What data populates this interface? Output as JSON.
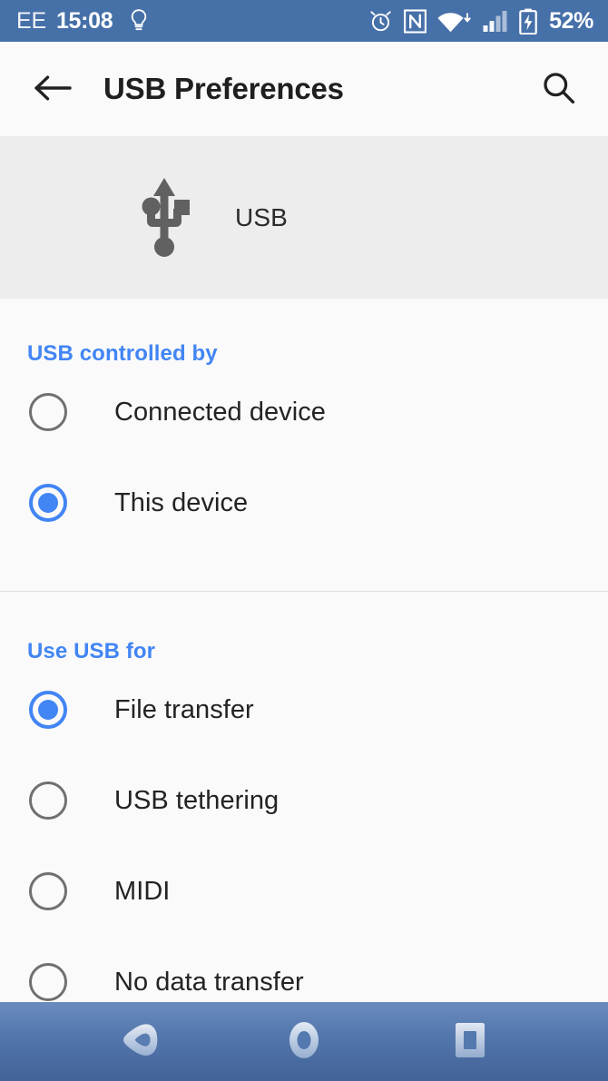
{
  "status_bar": {
    "carrier": "EE",
    "time": "15:08",
    "battery_percent": "52%",
    "background_color": "#4670A8",
    "icons": [
      {
        "name": "flashlight-bulb-icon",
        "label": "Flashlight"
      },
      {
        "name": "alarm-clock-icon",
        "label": "Alarm set"
      },
      {
        "name": "nfc-icon",
        "label": "NFC enabled"
      },
      {
        "name": "wifi-icon",
        "label": "Wi-Fi"
      },
      {
        "name": "cellular-signal-icon",
        "label": "Cellular signal"
      },
      {
        "name": "battery-charging-icon",
        "label": "Battery charging"
      }
    ]
  },
  "app_bar": {
    "title": "USB Preferences",
    "back_label": "Back",
    "search_label": "Search"
  },
  "usb_banner": {
    "label": "USB",
    "background_color": "#EDEDED",
    "icon": "usb-trident-icon"
  },
  "sections": [
    {
      "header": "USB controlled by",
      "header_color": "#4285F4",
      "options": [
        {
          "label": "Connected device",
          "selected": false
        },
        {
          "label": "This device",
          "selected": true
        }
      ]
    },
    {
      "header": "Use USB for",
      "header_color": "#4285F4",
      "options": [
        {
          "label": "File transfer",
          "selected": true
        },
        {
          "label": "USB tethering",
          "selected": false
        },
        {
          "label": "MIDI",
          "selected": false
        },
        {
          "label": "No data transfer",
          "selected": false
        }
      ]
    }
  ],
  "nav_bar": {
    "buttons": [
      {
        "name": "nav-back-button",
        "label": "Back"
      },
      {
        "name": "nav-home-button",
        "label": "Home"
      },
      {
        "name": "nav-recents-button",
        "label": "Recents"
      }
    ]
  },
  "theme": {
    "accent_blue": "#4285F4",
    "status_bar_blue": "#4670A8",
    "page_background": "#FAFAFA",
    "banner_gray": "#EDEDED",
    "text_primary": "#232323"
  }
}
